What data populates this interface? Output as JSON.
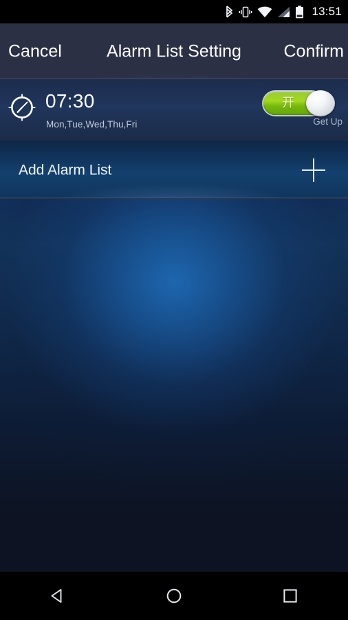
{
  "status_bar": {
    "time": "13:51",
    "icons": [
      "bluetooth-icon",
      "vibrate-icon",
      "wifi-icon",
      "cellular-signal-icon",
      "battery-icon"
    ]
  },
  "action_bar": {
    "cancel_label": "Cancel",
    "title": "Alarm List Setting",
    "confirm_label": "Confirm"
  },
  "alarm_list": {
    "items": [
      {
        "icon": "clock-icon",
        "time": "07:30",
        "days": "Mon,Tue,Wed,Thu,Fri",
        "toggle_state": "on",
        "toggle_label": "开",
        "caption": "Get Up"
      }
    ]
  },
  "add_row": {
    "label": "Add Alarm List",
    "icon": "plus-icon"
  },
  "nav_bar": {
    "back": "back-icon",
    "home": "home-icon",
    "recents": "recents-icon"
  },
  "colors": {
    "accent_green": "#9acd32",
    "status_bar_bg": "#000000",
    "action_bar_bg": "#2b3045",
    "wallpaper_blue": "#1e69b4",
    "wallpaper_dark": "#0d1322"
  }
}
